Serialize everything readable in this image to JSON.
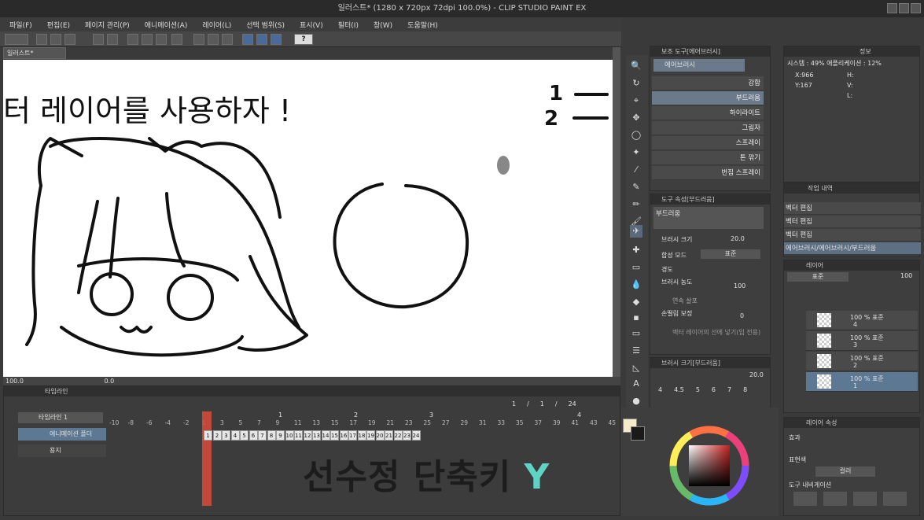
{
  "window": {
    "title": "일러스트* (1280 x 720px 72dpi 100.0%) - CLIP STUDIO PAINT EX"
  },
  "menu": [
    "파일(F)",
    "편집(E)",
    "페이지 관리(P)",
    "애니메이션(A)",
    "레이어(L)",
    "선택 범위(S)",
    "표시(V)",
    "필터(I)",
    "창(W)",
    "도움말(H)"
  ],
  "canvas": {
    "tab": "일러스트*",
    "text_heading": "터 레이어를 사용하자 !",
    "text_one": "1",
    "text_two": "2",
    "zoom": "100.0",
    "rotation": "0.0"
  },
  "subtool": {
    "header": "보조 도구[에어브러시]",
    "group": "에어브러시",
    "brushes": [
      {
        "label": "강함"
      },
      {
        "label": "부드러움"
      },
      {
        "label": "하이라이트"
      },
      {
        "label": "그림자"
      },
      {
        "label": "스프레이"
      },
      {
        "label": "톤 깎기"
      },
      {
        "label": "번짐 스프레이"
      }
    ]
  },
  "tool_property": {
    "header": "도구 속성[부드러움]",
    "name": "부드러움",
    "brush_size_label": "브러시 크기",
    "brush_size_value": "20.0",
    "blend_label": "합성 모드",
    "blend_value": "표준",
    "hardness_label": "경도",
    "density_label": "브러시 농도",
    "density_value": "100",
    "continuous_label": "연속 살포",
    "stabilization_label": "손떨림 보정",
    "stabilization_value": "0",
    "vector_label": "벡터 레이어의 선에 넣기(입 전용)"
  },
  "brush_size": {
    "header": "브러시 크기[부드러움]",
    "value": "20.0",
    "sizes": [
      "4",
      "4.5",
      "5",
      "6",
      "7",
      "8"
    ]
  },
  "navigator": {
    "tab": "정보",
    "zoom_line": "시스템 : 49% 애플리케이션 : 12%",
    "x": "X:966",
    "y": "Y:167",
    "h": "H:",
    "v": "V:",
    "l": "L:"
  },
  "history": {
    "tab": "작업 내역",
    "rows": [
      "벡터 편집",
      "벡터 편집",
      "벡터 편집",
      "에어브러시/에어브러시/부드러움"
    ]
  },
  "layers": {
    "tab": "레이어",
    "blend": "표준",
    "opacity": "100",
    "rows": [
      {
        "line1": "100 % 표준",
        "line2": "4"
      },
      {
        "line1": "100 % 표준",
        "line2": "3"
      },
      {
        "line1": "100 % 표준",
        "line2": "2"
      },
      {
        "line1": "100 % 표준",
        "line2": "1"
      }
    ]
  },
  "effect": {
    "tab": "레이어 속성",
    "effect_label": "효과",
    "express_label": "표현색",
    "express_value": "컬러",
    "nav_label": "도구 내비게이션"
  },
  "timeline": {
    "tab": "타임라인",
    "name": "타임라인 1",
    "frame_current": "1",
    "frame_sep": "/",
    "frame_total_1": "1",
    "frame_total_2": "24",
    "ruler": [
      "-10",
      "-8",
      "-6",
      "-4",
      "-2",
      "1",
      "3",
      "5",
      "7",
      "9",
      "11",
      "13",
      "15",
      "17",
      "19",
      "21",
      "23",
      "25",
      "27",
      "29",
      "31",
      "33",
      "35",
      "37",
      "39",
      "41",
      "43",
      "45"
    ],
    "markers": {
      "m1": "1",
      "m2": "2",
      "m3": "3",
      "m4": "4"
    },
    "track_anim": "애니메이션 폴더",
    "track_paper": "용지",
    "cels": [
      "1",
      "2",
      "3",
      "4",
      "5",
      "6",
      "7",
      "8",
      "9",
      "10",
      "11",
      "12",
      "13",
      "14",
      "15",
      "16",
      "17",
      "18",
      "19",
      "20",
      "21",
      "22",
      "23",
      "24"
    ]
  },
  "overlay": {
    "main": "선수정 단축키 ",
    "key": "Y"
  },
  "colors": {
    "main": "#1a1a1a",
    "sub": "#f5ebc8",
    "wheel_sel": "#c41f1f"
  }
}
